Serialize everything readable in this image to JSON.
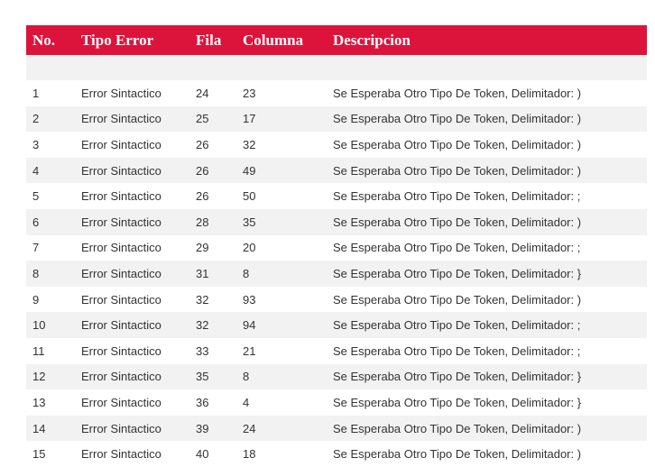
{
  "table": {
    "headers": [
      "No.",
      "Tipo Error",
      "Fila",
      "Columna",
      "Descripcion"
    ],
    "rows": [
      [
        "1",
        "Error Sintactico",
        "24",
        "23",
        "Se Esperaba Otro Tipo De Token, Delimitador: )"
      ],
      [
        "2",
        "Error Sintactico",
        "25",
        "17",
        "Se Esperaba Otro Tipo De Token, Delimitador: )"
      ],
      [
        "3",
        "Error Sintactico",
        "26",
        "32",
        "Se Esperaba Otro Tipo De Token, Delimitador: )"
      ],
      [
        "4",
        "Error Sintactico",
        "26",
        "49",
        "Se Esperaba Otro Tipo De Token, Delimitador: )"
      ],
      [
        "5",
        "Error Sintactico",
        "26",
        "50",
        "Se Esperaba Otro Tipo De Token, Delimitador: ;"
      ],
      [
        "6",
        "Error Sintactico",
        "28",
        "35",
        "Se Esperaba Otro Tipo De Token, Delimitador: )"
      ],
      [
        "7",
        "Error Sintactico",
        "29",
        "20",
        "Se Esperaba Otro Tipo De Token, Delimitador: ;"
      ],
      [
        "8",
        "Error Sintactico",
        "31",
        "8",
        "Se Esperaba Otro Tipo De Token, Delimitador: }"
      ],
      [
        "9",
        "Error Sintactico",
        "32",
        "93",
        "Se Esperaba Otro Tipo De Token, Delimitador: )"
      ],
      [
        "10",
        "Error Sintactico",
        "32",
        "94",
        "Se Esperaba Otro Tipo De Token, Delimitador: ;"
      ],
      [
        "11",
        "Error Sintactico",
        "33",
        "21",
        "Se Esperaba Otro Tipo De Token, Delimitador: ;"
      ],
      [
        "12",
        "Error Sintactico",
        "35",
        "8",
        "Se Esperaba Otro Tipo De Token, Delimitador: }"
      ],
      [
        "13",
        "Error Sintactico",
        "36",
        "4",
        "Se Esperaba Otro Tipo De Token, Delimitador: }"
      ],
      [
        "14",
        "Error Sintactico",
        "39",
        "24",
        "Se Esperaba Otro Tipo De Token, Delimitador: )"
      ],
      [
        "15",
        "Error Sintactico",
        "40",
        "18",
        "Se Esperaba Otro Tipo De Token, Delimitador: )"
      ]
    ]
  },
  "colors": {
    "header_bg": "#dc143c",
    "header_text": "#ffffff",
    "row_alt": "#f2f2f2",
    "body_text": "#333333"
  }
}
